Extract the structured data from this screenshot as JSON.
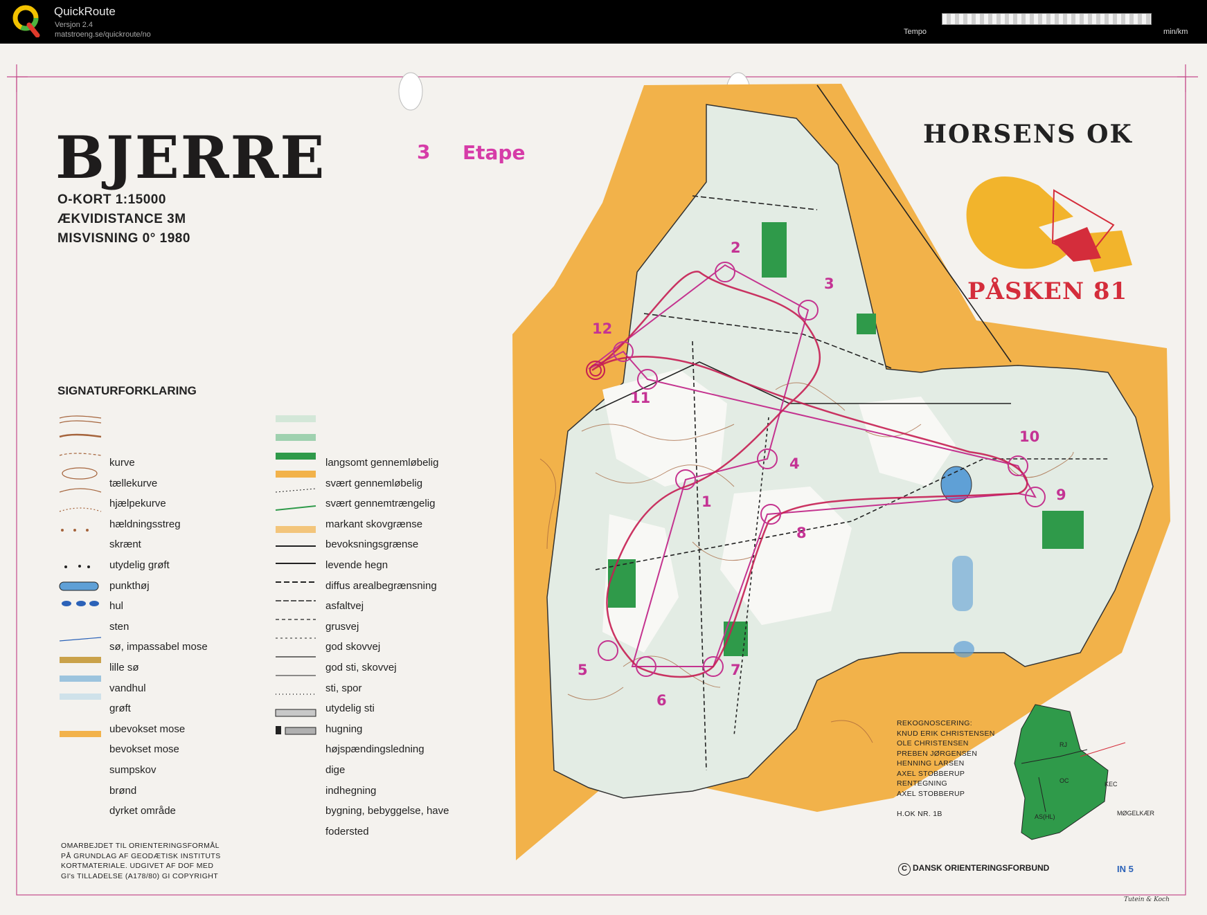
{
  "app": {
    "name": "QuickRoute",
    "version": "Versjon 2.4",
    "url": "matstroeng.se/quickroute/no"
  },
  "pace_scale": {
    "label": "Tempo",
    "unit": "min/km"
  },
  "map": {
    "title": "BJERRE",
    "stage_number": "3",
    "stage_word": "Etape",
    "specs": [
      "O-KORT  1:15000",
      "ÆKVIDISTANCE  3M",
      "MISVISNING  0° 1980"
    ],
    "club": "HORSENS  OK",
    "event": "PÅSKEN 81",
    "legend_title": "SIGNATURFORKLARING",
    "legend_left": [
      "kurve",
      "tællekurve",
      "hjælpekurve",
      "hældningsstreg",
      "skrænt",
      "utydelig grøft",
      "punkthøj",
      "hul",
      "sten",
      "sø, impassabel mose",
      "lille sø",
      "vandhul",
      "grøft",
      "ubevokset mose",
      "bevokset mose",
      "sumpskov",
      "brønd",
      "dyrket område"
    ],
    "legend_right": [
      "langsomt  gennemløbelig",
      "svært  gennemløbelig",
      "svært  gennemtrængelig",
      "markant skovgrænse",
      "bevoksningsgrænse",
      "levende hegn",
      "diffus arealbegrænsning",
      "asfaltvej",
      "grusvej",
      "god skovvej",
      "god sti, skovvej",
      "sti, spor",
      "utydelig sti",
      "hugning",
      "højspændingsledning",
      "dige",
      "indhegning",
      "bygning, bebyggelse, have",
      "fodersted"
    ],
    "footnote": [
      "OMARBEJDET TIL ORIENTERINGSFORMÅL",
      "PÅ GRUNDLAG AF GEODÆTISK INSTITUTS",
      "KORTMATERIALE. UDGIVET AF DOF  MED",
      "GI's TILLADELSE  (A178/80) GI  COPYRIGHT"
    ],
    "credits": [
      "REKOGNOSCERING:",
      "KNUD ERIK CHRISTENSEN",
      "OLE  CHRISTENSEN",
      "PREBEN  JØRGENSEN",
      "HENNING  LARSEN",
      "AXEL  STOBBERUP",
      "RENTEGNING",
      "AXEL  STOBBERUP",
      "",
      "H.OK  NR. 1B"
    ],
    "copyright": "DANSK  ORIENTERINGSFORBUND",
    "sheet_code": "IN 5",
    "printer": "Tutein & Koch",
    "inset_labels": [
      "RJ",
      "OC",
      "KEC",
      "AS(HL)",
      "MØGELKÆR"
    ],
    "control_numbers": [
      "1",
      "2",
      "3",
      "4",
      "5",
      "6",
      "7",
      "8",
      "9",
      "10",
      "11",
      "12"
    ],
    "colors": {
      "open_land": "#f2b24a",
      "forest": "#dfe9e2",
      "green_fight": "#2f9a4a",
      "course": "#c4338f",
      "route": "#c51e52",
      "water": "#5fa0d6",
      "logo_red": "#d42d3b",
      "logo_orange": "#f2b42c",
      "inset_green": "#2f9a4a"
    }
  }
}
